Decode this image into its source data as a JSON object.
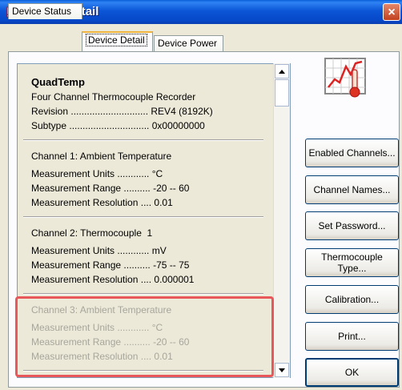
{
  "window": {
    "title": "Device Detail",
    "close_glyph": "×"
  },
  "tabs": [
    {
      "label": "Device Status",
      "active": false
    },
    {
      "label": "Device Detail",
      "active": true
    },
    {
      "label": "Device Power",
      "active": false
    }
  ],
  "device": {
    "name": "QuadTemp",
    "description": "Four Channel Thermocouple Recorder",
    "revision_label": "Revision .............................",
    "revision_value": "REV4 (8192K)",
    "subtype_label": "Subtype ..............................",
    "subtype_value": "0x00000000"
  },
  "channels": [
    {
      "title": "Channel 1: Ambient Temperature",
      "units_label": "Measurement Units ............",
      "units_value": "°C",
      "range_label": "Measurement Range ..........",
      "range_value": "-20 -- 60",
      "resolution_label": "Measurement Resolution ....",
      "resolution_value": "0.01",
      "enabled": true
    },
    {
      "title": "Channel 2: Thermocouple  1",
      "units_label": "Measurement Units ............",
      "units_value": "mV",
      "range_label": "Measurement Range ..........",
      "range_value": "-75 -- 75",
      "resolution_label": "Measurement Resolution ....",
      "resolution_value": "0.000001",
      "enabled": true
    },
    {
      "title": "Channel 3: Ambient Temperature",
      "units_label": "Measurement Units ............",
      "units_value": "°C",
      "range_label": "Measurement Range ..........",
      "range_value": "-20 -- 60",
      "resolution_label": "Measurement Resolution ....",
      "resolution_value": "0.01",
      "enabled": false
    }
  ],
  "buttons": {
    "enabled_channels": "Enabled Channels...",
    "channel_names": "Channel Names...",
    "set_password": "Set Password...",
    "thermocouple_type_1": "Thermocouple",
    "thermocouple_type_2": "Type...",
    "calibration": "Calibration...",
    "print": "Print...",
    "ok": "OK"
  },
  "icons": {
    "device_icon": "thermometer-chart-icon",
    "app_icon": "app-icon"
  },
  "colors": {
    "titlebar": "#0a5fd8",
    "highlight": "#e8585a",
    "disabled_text": "#a7a69c"
  }
}
